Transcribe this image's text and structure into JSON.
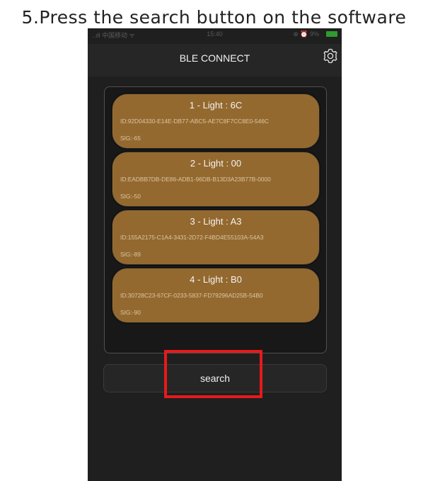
{
  "caption": "5.Press the search button on the software",
  "status_bar": {
    "carrier": "..ıll 中国移动 ᯤ",
    "time": "15:40",
    "right": "⊕ ⏰ 9%"
  },
  "navbar": {
    "title": "BLE CONNECT",
    "settings_icon": "gear-icon"
  },
  "devices": [
    {
      "name": "1 - Light : 6C",
      "id": "ID:92D04330-E14E-DB77-ABC5-AE7C8F7CC8E0-546C",
      "sig": "SIG:-65"
    },
    {
      "name": "2 - Light : 00",
      "id": "ID:EADBB7DB-DE86-ADB1-96DB-B13D3A23B77B-0000",
      "sig": "SIG:-50"
    },
    {
      "name": "3 - Light : A3",
      "id": "ID:155A2175-C1A4-3431-2D72-F4BD4E55103A-54A3",
      "sig": "SIG:-89"
    },
    {
      "name": "4 - Light : B0",
      "id": "ID:30728C23-67CF-0233-5837-FD79296AD25B-54B0",
      "sig": "SIG:-90"
    }
  ],
  "search_button": {
    "label": "search"
  },
  "colors": {
    "card": "#94692f",
    "background": "#1f1f1f",
    "highlight": "#e8191b"
  }
}
